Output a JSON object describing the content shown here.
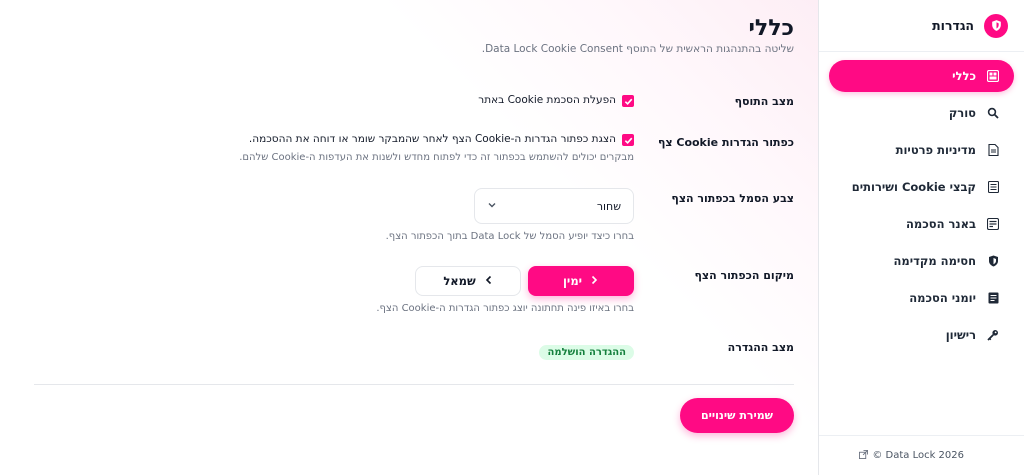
{
  "sidebar": {
    "title": "הגדרות",
    "items": [
      {
        "label": "כללי",
        "icon": "dashboard-icon",
        "active": true
      },
      {
        "label": "סורק",
        "icon": "search-icon",
        "active": false
      },
      {
        "label": "מדיניות פרטיות",
        "icon": "document-icon",
        "active": false
      },
      {
        "label": "קבצי Cookie ושירותים",
        "icon": "list-icon",
        "active": false
      },
      {
        "label": "באנר הסכמה",
        "icon": "banner-icon",
        "active": false
      },
      {
        "label": "חסימה מקדימה",
        "icon": "shield-icon",
        "active": false
      },
      {
        "label": "יומני הסכמה",
        "icon": "log-icon",
        "active": false
      },
      {
        "label": "רישיון",
        "icon": "key-icon",
        "active": false
      }
    ],
    "footer": "© Data Lock 2026"
  },
  "main": {
    "title": "כללי",
    "subtitle": "שליטה בהתנהגות הראשית של התוסף Data Lock Cookie Consent.",
    "plugin_state": {
      "label": "מצב התוסף",
      "checkbox_label": "הפעלת הסכמת Cookie באתר",
      "checked": true
    },
    "floating_button": {
      "label": "כפתור הגדרות Cookie צף",
      "checkbox_label": "הצגת כפתור הגדרות ה-Cookie הצף לאחר שהמבקר שומר או דוחה את ההסכמה.",
      "help": "מבקרים יכולים להשתמש בכפתור זה כדי לפתוח מחדש ולשנות את העדפות ה-Cookie שלהם.",
      "checked": true
    },
    "icon_color": {
      "label": "צבע הסמל בכפתור הצף",
      "value": "שחור",
      "help": "בחרו כיצד יופיע הסמל של Data Lock בתוך הכפתור הצף."
    },
    "position": {
      "label": "מיקום הכפתור הצף",
      "right_label": "ימין",
      "left_label": "שמאל",
      "selected": "ימין",
      "help": "בחרו באיזו פינה תחתונה יוצג כפתור הגדרות ה-Cookie הצף."
    },
    "setup_state": {
      "label": "מצב ההגדרה",
      "badge": "ההגדרה הושלמה"
    },
    "save_label": "שמירת שינויים"
  },
  "colors": {
    "accent": "#ff0a84",
    "success_bg": "#dcfce7",
    "success_text": "#15803d"
  }
}
